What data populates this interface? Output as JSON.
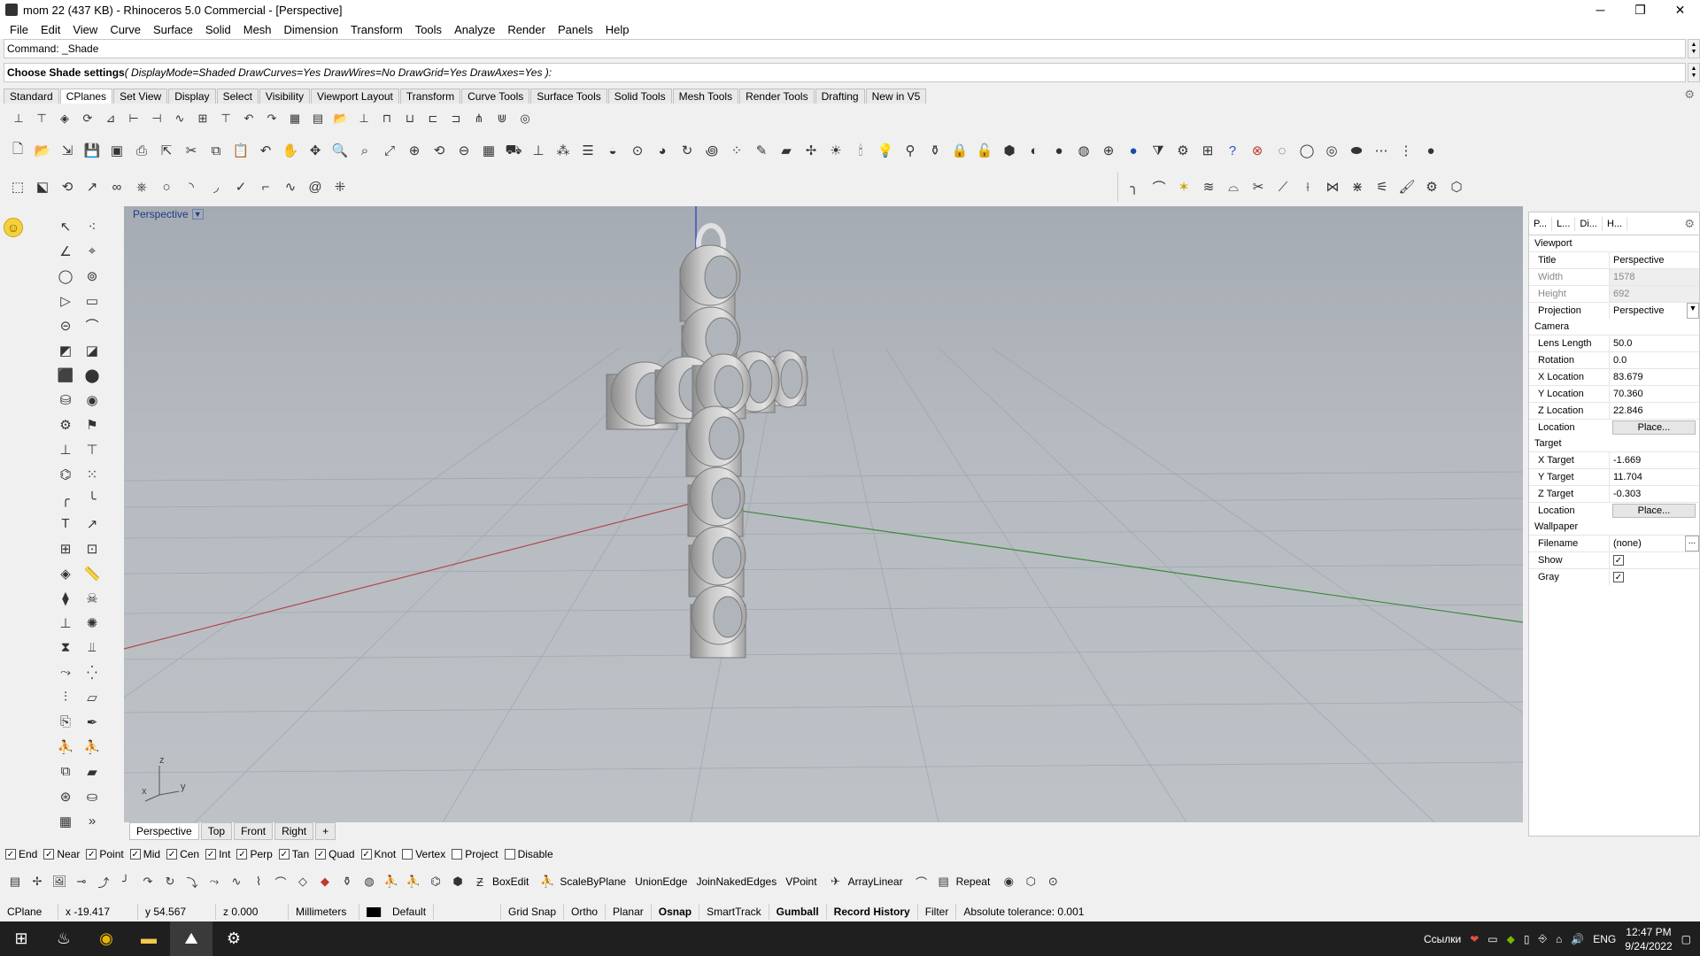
{
  "window": {
    "title": "mom 22 (437 KB) - Rhinoceros 5.0 Commercial - [Perspective]",
    "controls": [
      "─",
      "❐",
      "✕"
    ]
  },
  "menu": [
    "File",
    "Edit",
    "View",
    "Curve",
    "Surface",
    "Solid",
    "Mesh",
    "Dimension",
    "Transform",
    "Tools",
    "Analyze",
    "Render",
    "Panels",
    "Help"
  ],
  "command": {
    "history": "Command: _Shade",
    "prompt_bold": "Choose Shade settings",
    "prompt_options": " ( DisplayMode=Shaded  DrawCurves=Yes  DrawWires=No  DrawGrid=Yes  DrawAxes=Yes ):"
  },
  "toolbar_tabs": [
    "Standard",
    "CPlanes",
    "Set View",
    "Display",
    "Select",
    "Visibility",
    "Viewport Layout",
    "Transform",
    "Curve Tools",
    "Surface Tools",
    "Solid Tools",
    "Mesh Tools",
    "Render Tools",
    "Drafting",
    "New in V5"
  ],
  "active_toolbar_tab": "CPlanes",
  "viewport": {
    "label": "Perspective",
    "tabs": [
      "Perspective",
      "Top",
      "Front",
      "Right",
      "+"
    ],
    "active_tab": "Perspective",
    "axes": {
      "z": "z",
      "x": "x",
      "y": "y"
    }
  },
  "properties": {
    "tabs": [
      "P...",
      "L...",
      "Di...",
      "H..."
    ],
    "viewport_section": "Viewport",
    "title_label": "Title",
    "title_value": "Perspective",
    "width_label": "Width",
    "width_value": "1578",
    "height_label": "Height",
    "height_value": "692",
    "projection_label": "Projection",
    "projection_value": "Perspective",
    "camera_section": "Camera",
    "lens_label": "Lens Length",
    "lens_value": "50.0",
    "rotation_label": "Rotation",
    "rotation_value": "0.0",
    "xloc_label": "X Location",
    "xloc_value": "83.679",
    "yloc_label": "Y Location",
    "yloc_value": "70.360",
    "zloc_label": "Z Location",
    "zloc_value": "22.846",
    "location_label": "Location",
    "place_label": "Place...",
    "target_section": "Target",
    "xt_label": "X Target",
    "xt_value": "-1.669",
    "yt_label": "Y Target",
    "yt_value": "11.704",
    "zt_label": "Z Target",
    "zt_value": "-0.303",
    "tlocation_label": "Location",
    "tplace_label": "Place...",
    "wallpaper_section": "Wallpaper",
    "filename_label": "Filename",
    "filename_value": "(none)",
    "filename_btn": "...",
    "show_label": "Show",
    "gray_label": "Gray"
  },
  "osnap": {
    "items": [
      {
        "label": "End",
        "checked": true
      },
      {
        "label": "Near",
        "checked": true
      },
      {
        "label": "Point",
        "checked": true
      },
      {
        "label": "Mid",
        "checked": true
      },
      {
        "label": "Cen",
        "checked": true
      },
      {
        "label": "Int",
        "checked": true
      },
      {
        "label": "Perp",
        "checked": true
      },
      {
        "label": "Tan",
        "checked": true
      },
      {
        "label": "Quad",
        "checked": true
      },
      {
        "label": "Knot",
        "checked": true
      },
      {
        "label": "Vertex",
        "checked": false
      },
      {
        "label": "Project",
        "checked": false
      },
      {
        "label": "Disable",
        "checked": false
      }
    ]
  },
  "bottom_toolbar": {
    "boxedit": "BoxEdit",
    "scalebyplane": "ScaleByPlane",
    "unionedge": "UnionEdge",
    "joinnaked": "JoinNakedEdges",
    "vpoint": "VPoint",
    "arraylinear": "ArrayLinear",
    "repeat": "Repeat"
  },
  "status": {
    "cplane": "CPlane",
    "x": "x -19.417",
    "y": "y 54.567",
    "z": "z 0.000",
    "units": "Millimeters",
    "layer": "Default",
    "gridsnap": "Grid Snap",
    "ortho": "Ortho",
    "planar": "Planar",
    "osnap": "Osnap",
    "smarttrack": "SmartTrack",
    "gumball": "Gumball",
    "record": "Record History",
    "filter": "Filter",
    "tolerance": "Absolute tolerance: 0.001"
  },
  "taskbar": {
    "lang_word": "Ссылки",
    "lang": "ENG",
    "time": "12:47 PM",
    "date": "9/24/2022"
  },
  "colors": {
    "x_axis": "#b04a4a",
    "y_axis": "#3b8a3b",
    "z_axis": "#3a4fc0",
    "viewport_bg": "#b1b6bd"
  }
}
